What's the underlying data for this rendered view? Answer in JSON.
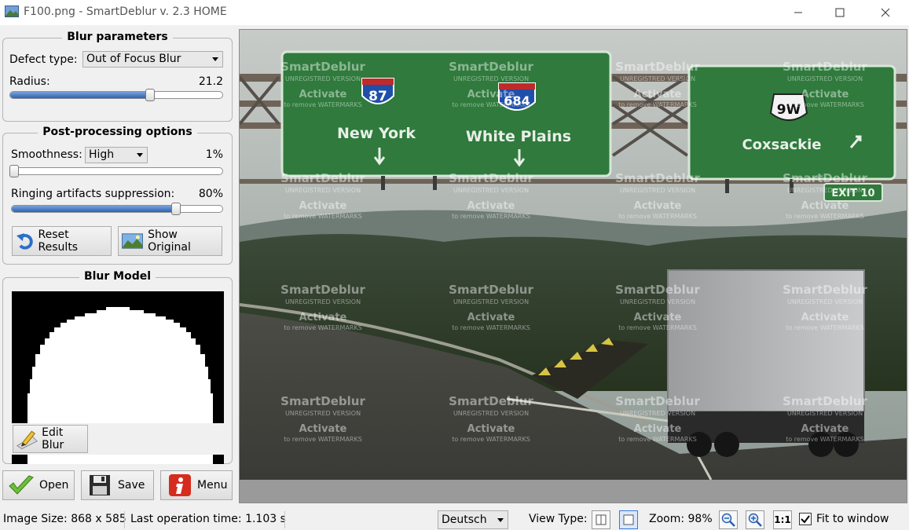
{
  "window": {
    "title": "F100.png - SmartDeblur v. 2.3 HOME"
  },
  "blur_parameters": {
    "title": "Blur parameters",
    "defect_type_label": "Defect type:",
    "defect_type_value": "Out of Focus Blur",
    "radius_label": "Radius:",
    "radius_value": "21.2",
    "radius_fraction": 0.66
  },
  "post_processing": {
    "title": "Post-processing options",
    "smoothness_label": "Smoothness:",
    "smoothness_value": "High",
    "smoothness_percent": "1%",
    "smoothness_fraction": 0.01,
    "ringing_label": "Ringing artifacts suppression:",
    "ringing_percent": "80%",
    "ringing_fraction": 0.78,
    "reset_label": "Reset Results",
    "show_original_label": "Show Original"
  },
  "blur_model": {
    "title": "Blur Model",
    "edit_label": "Edit Blur"
  },
  "actions": {
    "open_label": "Open",
    "save_label": "Save",
    "menu_label": "Menu"
  },
  "image": {
    "signs": [
      {
        "shield": "87",
        "label": "New York"
      },
      {
        "shield": "684",
        "label": "White Plains"
      },
      {
        "shield": "9W",
        "label": "Coxsackie"
      }
    ],
    "exit_label": "EXIT 10",
    "watermark": {
      "line1": "SmartDeblur",
      "line2": "UNREGISTRED VERSION",
      "line3": "Activate",
      "line4": "to remove WATERMARKS"
    }
  },
  "status": {
    "image_size": "Image Size: 868 x 585",
    "last_operation": "Last operation time: 1.103 s",
    "language": "Deutsch",
    "view_type_label": "View Type:",
    "zoom_label": "Zoom: 98%",
    "one_to_one": "1:1",
    "fit_to_window_label": "Fit to window",
    "fit_to_window_checked": true
  },
  "colors": {
    "slider_fill": "#2e62b3",
    "sign_green": "#2f7a3c",
    "menu_icon_red": "#d62b1f"
  }
}
